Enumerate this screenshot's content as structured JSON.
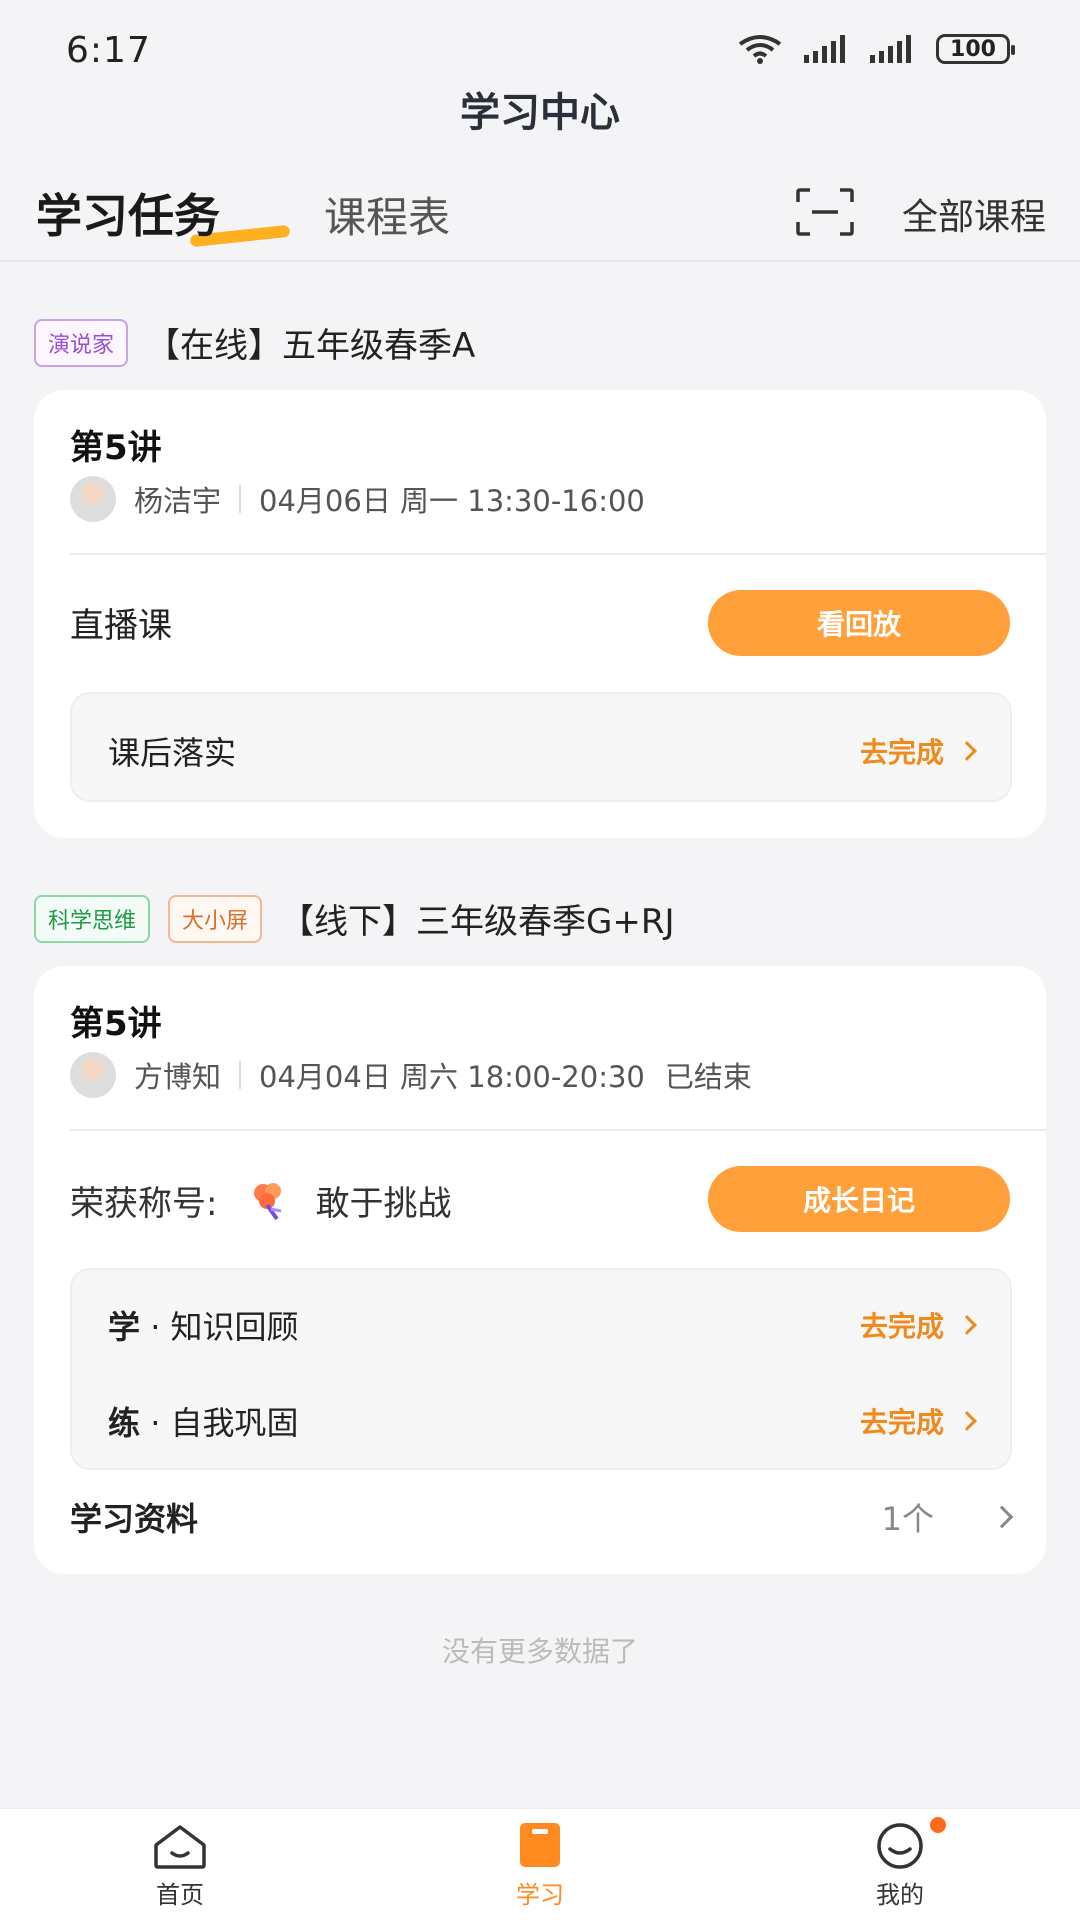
{
  "status": {
    "time": "6:17",
    "battery": "100"
  },
  "header": {
    "title": "学习中心"
  },
  "tabs": {
    "active": "学习任务",
    "inactive": "课程表",
    "all_courses": "全部课程"
  },
  "groups": [
    {
      "tags": [
        "演说家"
      ],
      "title": "【在线】五年级春季A",
      "card": {
        "lesson": "第5讲",
        "teacher": "杨洁宇",
        "time": "04月06日 周一 13:30-16:00",
        "row_label": "直播课",
        "button": "看回放",
        "tasks": [
          {
            "label": "课后落实",
            "action": "去完成"
          }
        ]
      }
    },
    {
      "tags": [
        "科学思维",
        "大小屏"
      ],
      "title": "【线下】三年级春季G+RJ",
      "card": {
        "lesson": "第5讲",
        "teacher": "方博知",
        "time": "04月04日 周六 18:00-20:30",
        "status": "已结束",
        "honor_prefix": "荣获称号:",
        "honor": "敢于挑战",
        "button": "成长日记",
        "tasks": [
          {
            "label_bold": "学",
            "label": " · 知识回顾",
            "action": "去完成"
          },
          {
            "label_bold": "练",
            "label": " · 自我巩固",
            "action": "去完成"
          }
        ],
        "materials_label": "学习资料",
        "materials_count": "1个"
      }
    }
  ],
  "footer_note": "没有更多数据了",
  "bottom_nav": [
    {
      "label": "首页",
      "icon": "home-icon"
    },
    {
      "label": "学习",
      "icon": "study-icon"
    },
    {
      "label": "我的",
      "icon": "profile-icon"
    }
  ],
  "colors": {
    "accent": "#ffa03a",
    "action": "#f08a1c",
    "background": "#f4f4f6"
  }
}
